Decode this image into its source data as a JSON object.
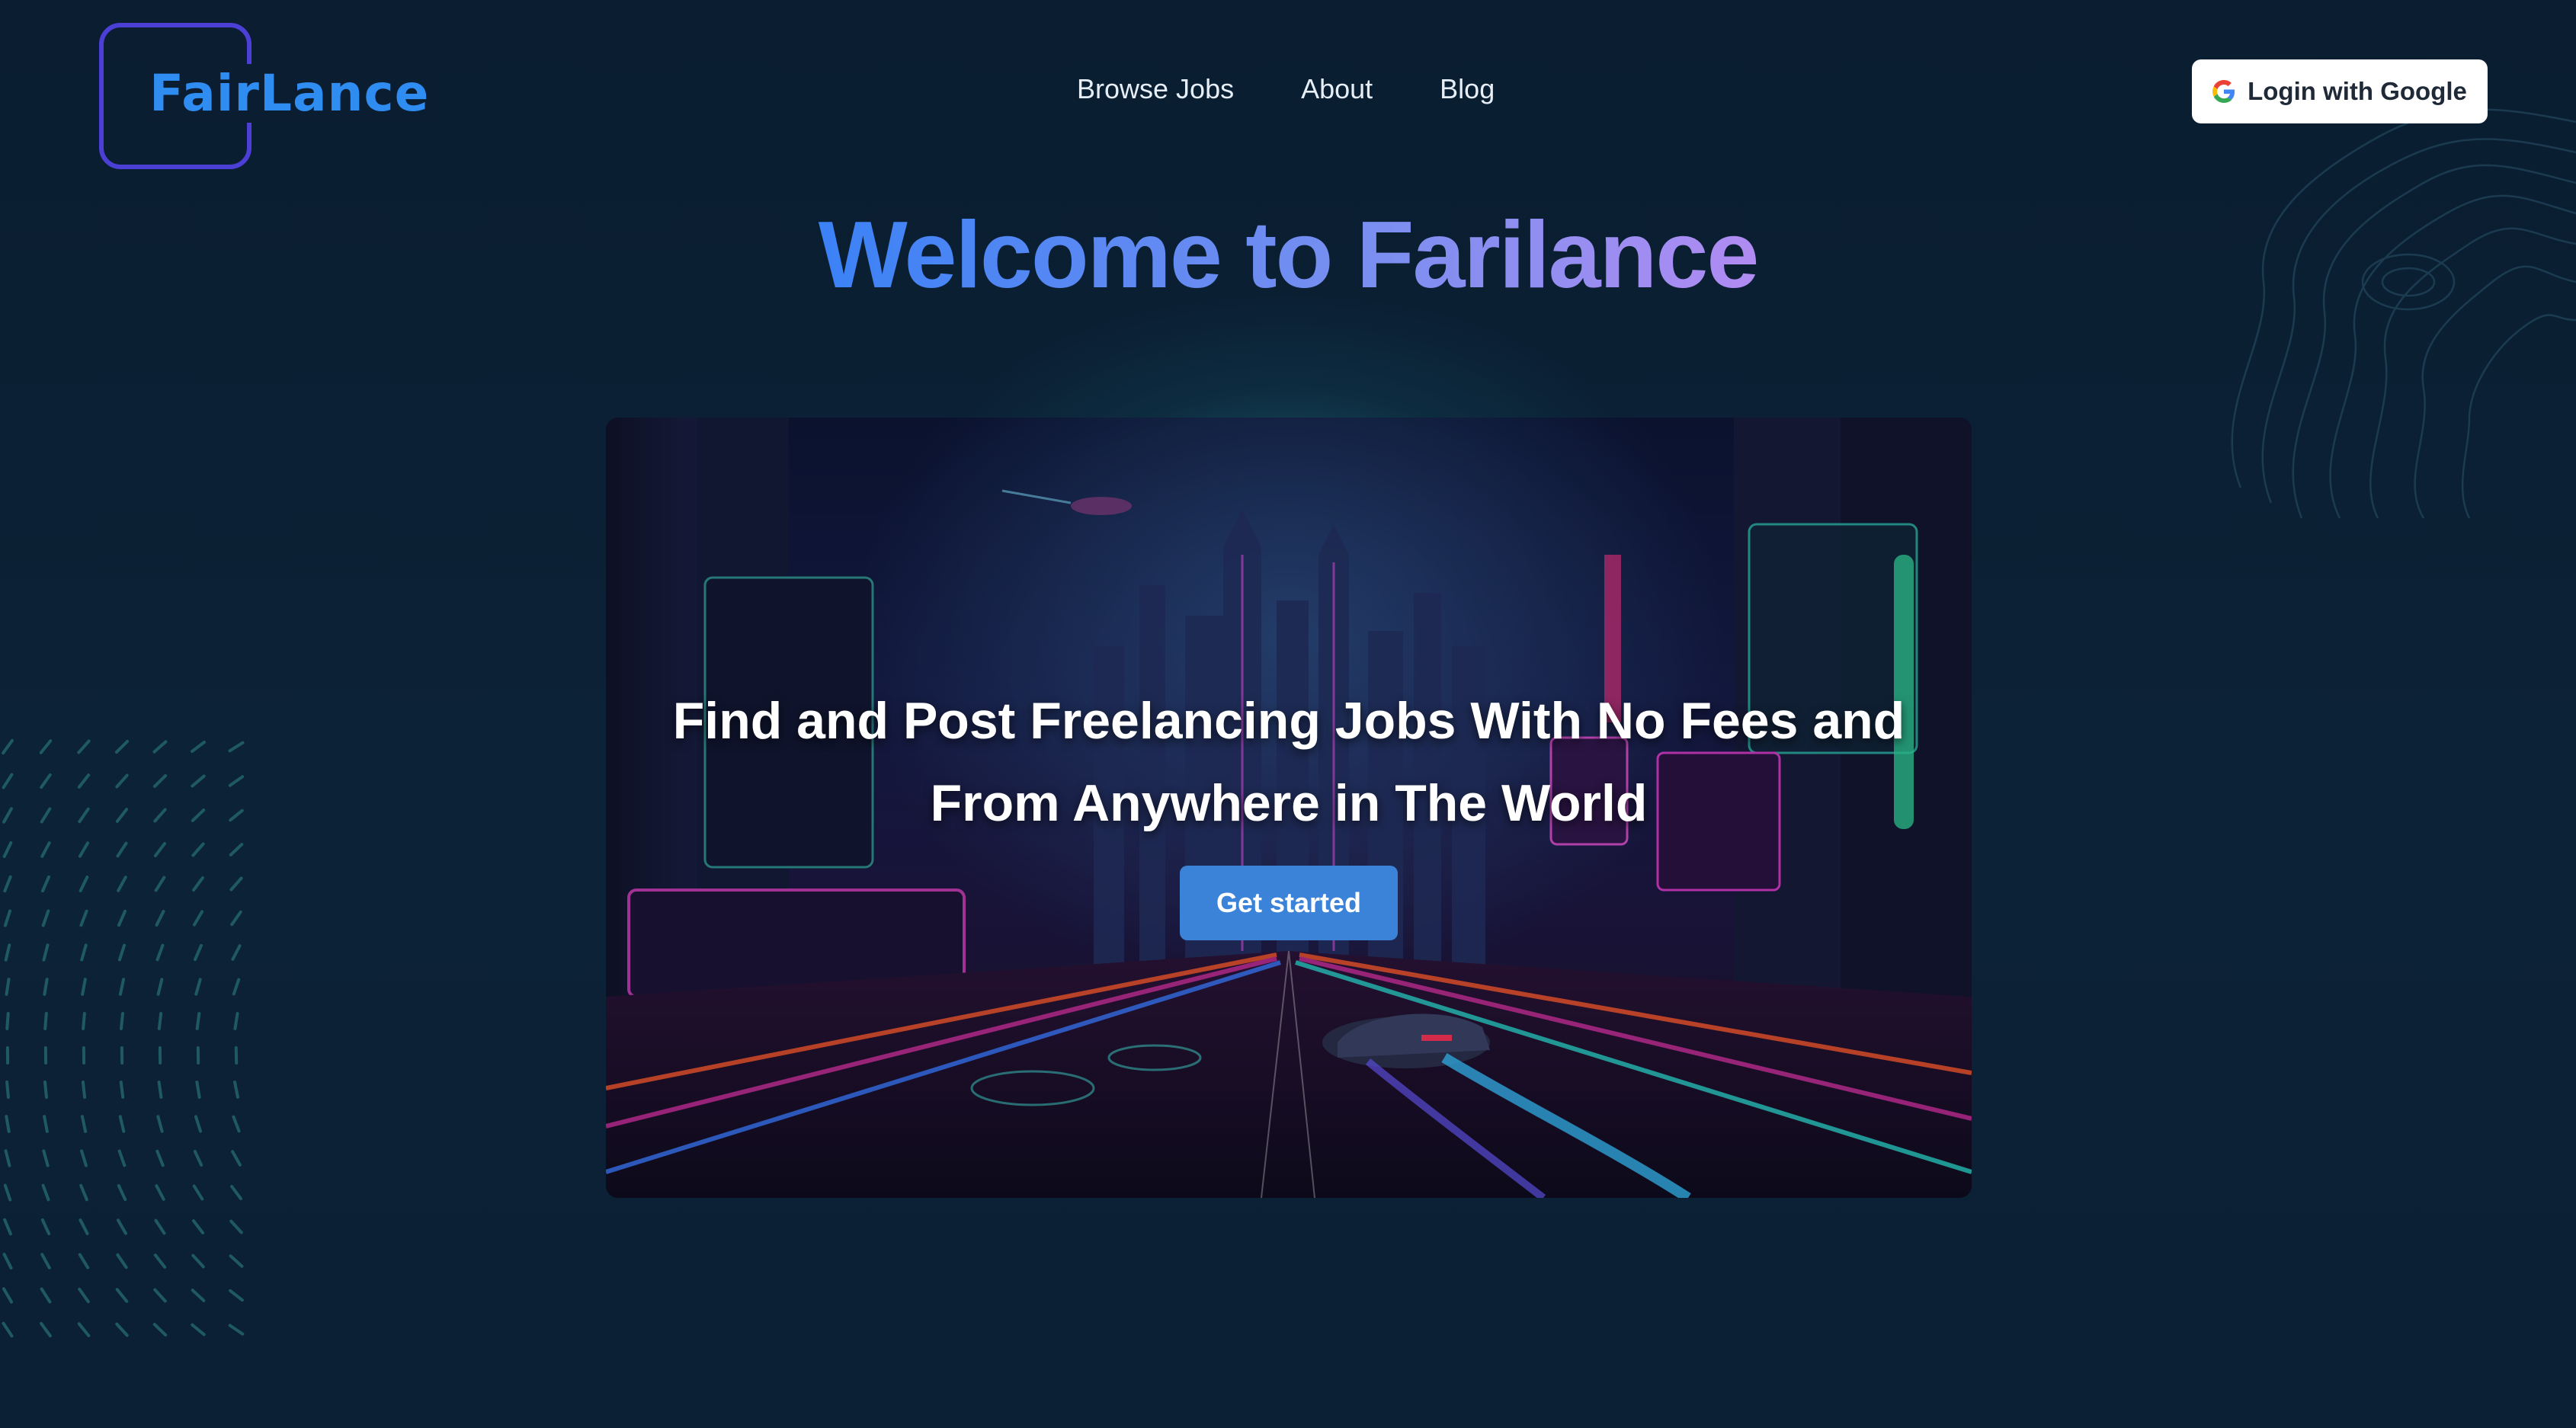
{
  "header": {
    "logo_text": "FairLance",
    "nav": [
      {
        "label": "Browse Jobs"
      },
      {
        "label": "About"
      },
      {
        "label": "Blog"
      }
    ],
    "login_label": "Login with Google",
    "login_icon": "google-icon"
  },
  "hero": {
    "title": "Welcome to Farilance"
  },
  "banner": {
    "heading_line1": "Find and Post Freelancing Jobs With No Fees and",
    "heading_line2": "From Anywhere in The World",
    "cta_label": "Get started"
  },
  "colors": {
    "background": "#0b1f33",
    "logo_border": "#4b3fd6",
    "logo_text": "#2f8cf0",
    "title_gradient_start": "#3b82f6",
    "title_gradient_end": "#b18cf2",
    "cta": "#3b82d9"
  }
}
